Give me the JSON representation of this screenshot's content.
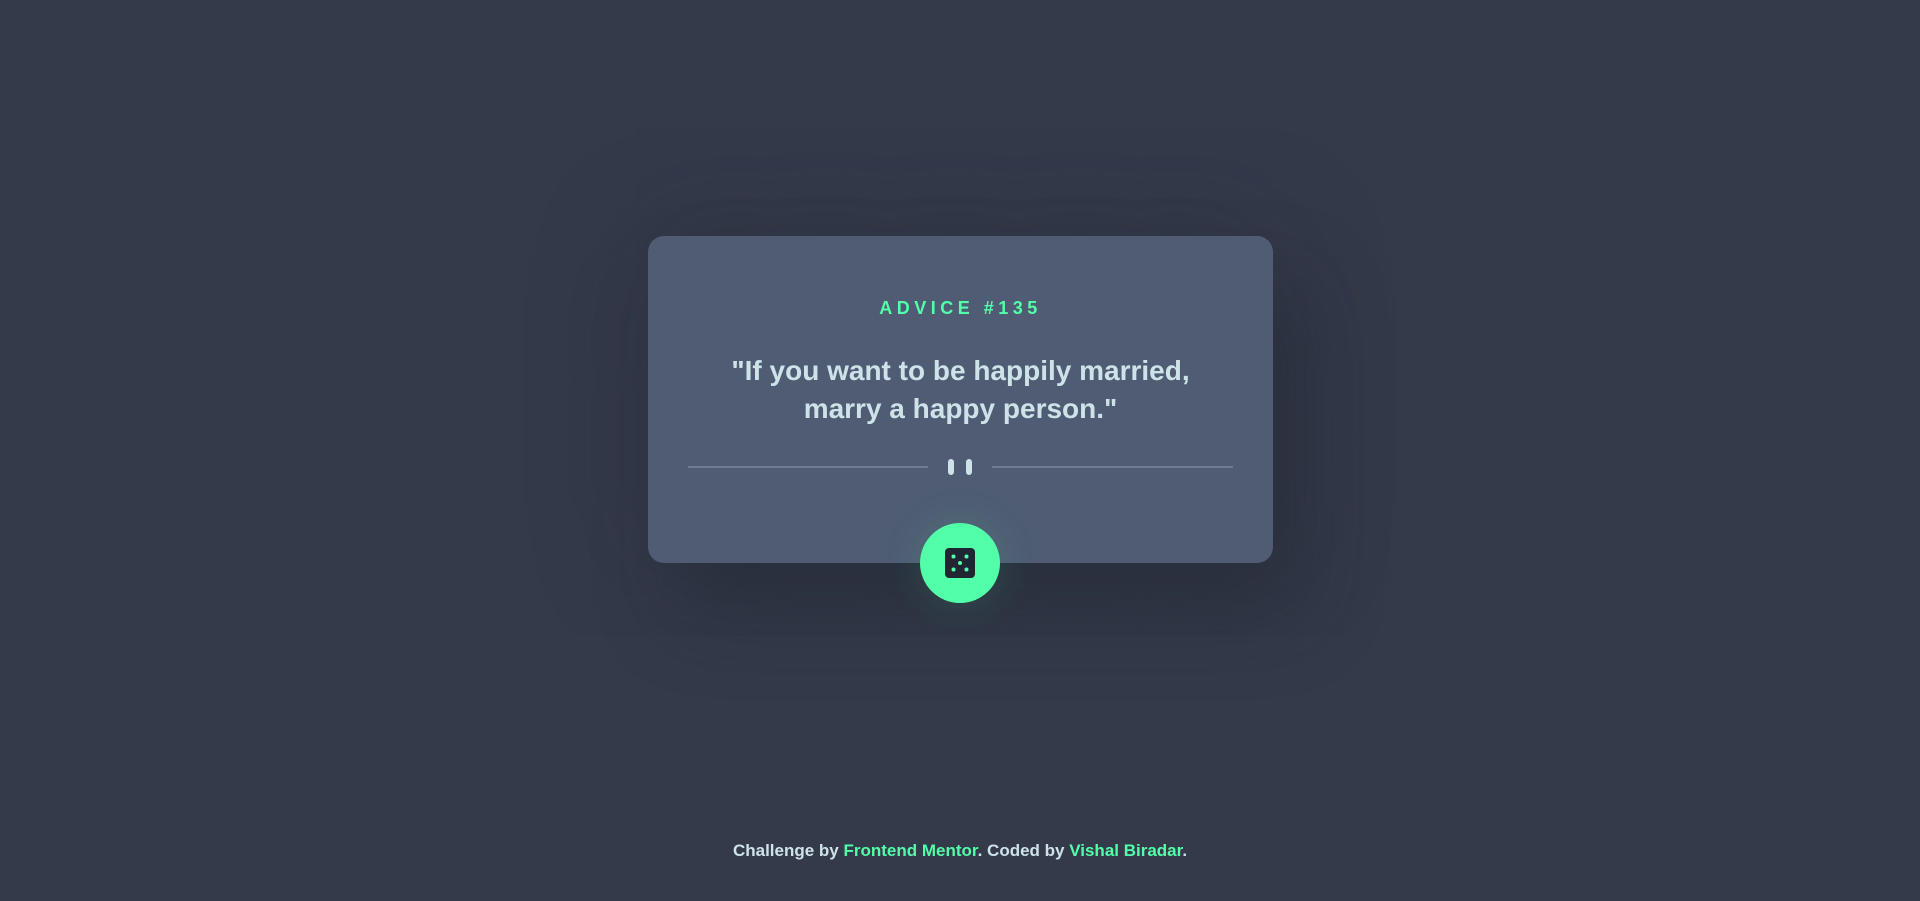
{
  "card": {
    "advice_label": "ADVICE #135",
    "quote_line1": "\"If you want to be happily married,",
    "quote_line2": "marry a happy person.\""
  },
  "divider": {
    "icon": "pause-icon"
  },
  "dice_button": {
    "icon": "dice-icon"
  },
  "footer": {
    "prefix": "Challenge by ",
    "challenge_link": "Frontend Mentor",
    "middle": ". Coded by ",
    "author_link": "Vishal Biradar",
    "suffix": "."
  },
  "colors": {
    "background": "#343a4a",
    "card": "#4f5c73",
    "accent": "#52ffa8",
    "text": "#cee3e9",
    "divider_line": "#7a8597"
  }
}
